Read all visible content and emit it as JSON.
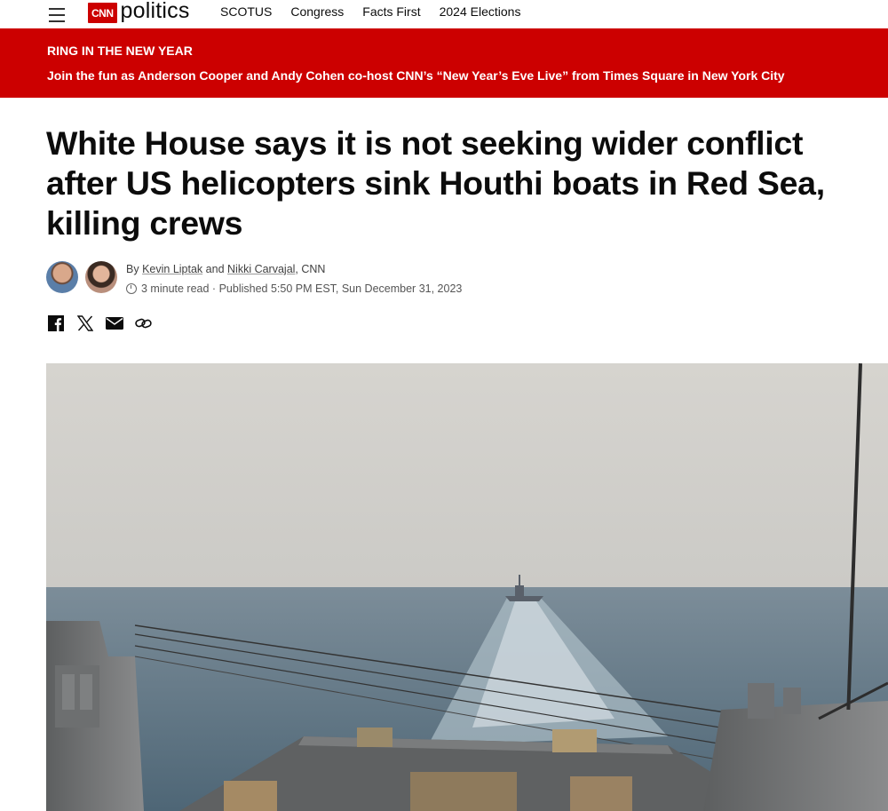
{
  "nav": {
    "menu_icon": "hamburger-menu-icon",
    "logo_text": "CNN",
    "section": "politics",
    "links": [
      "SCOTUS",
      "Congress",
      "Facts First",
      "2024 Elections"
    ]
  },
  "banner": {
    "eyebrow": "RING IN THE NEW YEAR",
    "text": "Join the fun as Anderson Cooper and Andy Cohen co-host CNN’s “New Year’s Eve Live” from Times Square in New York City",
    "color": "#cc0000"
  },
  "article": {
    "headline": "White House says it is not seeking wider conflict after US helicopters sink Houthi boats in Red Sea, killing crews",
    "byline_prefix": "By",
    "author1": "Kevin Liptak",
    "and": "and",
    "author2": "Nikki Carvajal",
    "outlet": ", CNN",
    "read_time": "3 minute read",
    "separator": "·",
    "published": "Published 5:50 PM EST, Sun December 31, 2023"
  },
  "share_icons": [
    "facebook-icon",
    "x-icon",
    "email-icon",
    "link-icon"
  ]
}
